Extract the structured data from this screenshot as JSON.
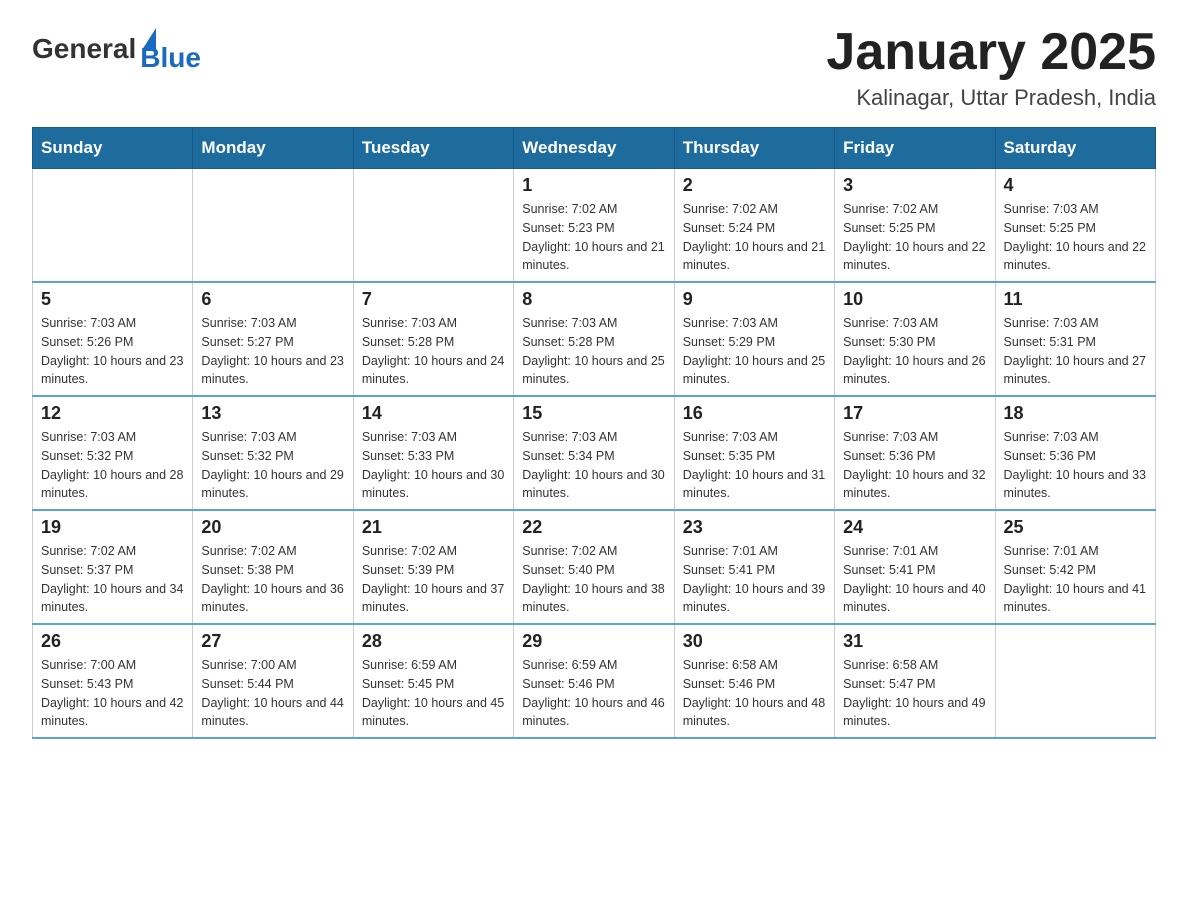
{
  "header": {
    "logo": {
      "text_general": "General",
      "text_blue": "Blue",
      "triangle_label": "logo-triangle"
    },
    "title": "January 2025",
    "subtitle": "Kalinagar, Uttar Pradesh, India"
  },
  "calendar": {
    "days_of_week": [
      "Sunday",
      "Monday",
      "Tuesday",
      "Wednesday",
      "Thursday",
      "Friday",
      "Saturday"
    ],
    "weeks": [
      [
        {
          "day": "",
          "info": ""
        },
        {
          "day": "",
          "info": ""
        },
        {
          "day": "",
          "info": ""
        },
        {
          "day": "1",
          "info": "Sunrise: 7:02 AM\nSunset: 5:23 PM\nDaylight: 10 hours and 21 minutes."
        },
        {
          "day": "2",
          "info": "Sunrise: 7:02 AM\nSunset: 5:24 PM\nDaylight: 10 hours and 21 minutes."
        },
        {
          "day": "3",
          "info": "Sunrise: 7:02 AM\nSunset: 5:25 PM\nDaylight: 10 hours and 22 minutes."
        },
        {
          "day": "4",
          "info": "Sunrise: 7:03 AM\nSunset: 5:25 PM\nDaylight: 10 hours and 22 minutes."
        }
      ],
      [
        {
          "day": "5",
          "info": "Sunrise: 7:03 AM\nSunset: 5:26 PM\nDaylight: 10 hours and 23 minutes."
        },
        {
          "day": "6",
          "info": "Sunrise: 7:03 AM\nSunset: 5:27 PM\nDaylight: 10 hours and 23 minutes."
        },
        {
          "day": "7",
          "info": "Sunrise: 7:03 AM\nSunset: 5:28 PM\nDaylight: 10 hours and 24 minutes."
        },
        {
          "day": "8",
          "info": "Sunrise: 7:03 AM\nSunset: 5:28 PM\nDaylight: 10 hours and 25 minutes."
        },
        {
          "day": "9",
          "info": "Sunrise: 7:03 AM\nSunset: 5:29 PM\nDaylight: 10 hours and 25 minutes."
        },
        {
          "day": "10",
          "info": "Sunrise: 7:03 AM\nSunset: 5:30 PM\nDaylight: 10 hours and 26 minutes."
        },
        {
          "day": "11",
          "info": "Sunrise: 7:03 AM\nSunset: 5:31 PM\nDaylight: 10 hours and 27 minutes."
        }
      ],
      [
        {
          "day": "12",
          "info": "Sunrise: 7:03 AM\nSunset: 5:32 PM\nDaylight: 10 hours and 28 minutes."
        },
        {
          "day": "13",
          "info": "Sunrise: 7:03 AM\nSunset: 5:32 PM\nDaylight: 10 hours and 29 minutes."
        },
        {
          "day": "14",
          "info": "Sunrise: 7:03 AM\nSunset: 5:33 PM\nDaylight: 10 hours and 30 minutes."
        },
        {
          "day": "15",
          "info": "Sunrise: 7:03 AM\nSunset: 5:34 PM\nDaylight: 10 hours and 30 minutes."
        },
        {
          "day": "16",
          "info": "Sunrise: 7:03 AM\nSunset: 5:35 PM\nDaylight: 10 hours and 31 minutes."
        },
        {
          "day": "17",
          "info": "Sunrise: 7:03 AM\nSunset: 5:36 PM\nDaylight: 10 hours and 32 minutes."
        },
        {
          "day": "18",
          "info": "Sunrise: 7:03 AM\nSunset: 5:36 PM\nDaylight: 10 hours and 33 minutes."
        }
      ],
      [
        {
          "day": "19",
          "info": "Sunrise: 7:02 AM\nSunset: 5:37 PM\nDaylight: 10 hours and 34 minutes."
        },
        {
          "day": "20",
          "info": "Sunrise: 7:02 AM\nSunset: 5:38 PM\nDaylight: 10 hours and 36 minutes."
        },
        {
          "day": "21",
          "info": "Sunrise: 7:02 AM\nSunset: 5:39 PM\nDaylight: 10 hours and 37 minutes."
        },
        {
          "day": "22",
          "info": "Sunrise: 7:02 AM\nSunset: 5:40 PM\nDaylight: 10 hours and 38 minutes."
        },
        {
          "day": "23",
          "info": "Sunrise: 7:01 AM\nSunset: 5:41 PM\nDaylight: 10 hours and 39 minutes."
        },
        {
          "day": "24",
          "info": "Sunrise: 7:01 AM\nSunset: 5:41 PM\nDaylight: 10 hours and 40 minutes."
        },
        {
          "day": "25",
          "info": "Sunrise: 7:01 AM\nSunset: 5:42 PM\nDaylight: 10 hours and 41 minutes."
        }
      ],
      [
        {
          "day": "26",
          "info": "Sunrise: 7:00 AM\nSunset: 5:43 PM\nDaylight: 10 hours and 42 minutes."
        },
        {
          "day": "27",
          "info": "Sunrise: 7:00 AM\nSunset: 5:44 PM\nDaylight: 10 hours and 44 minutes."
        },
        {
          "day": "28",
          "info": "Sunrise: 6:59 AM\nSunset: 5:45 PM\nDaylight: 10 hours and 45 minutes."
        },
        {
          "day": "29",
          "info": "Sunrise: 6:59 AM\nSunset: 5:46 PM\nDaylight: 10 hours and 46 minutes."
        },
        {
          "day": "30",
          "info": "Sunrise: 6:58 AM\nSunset: 5:46 PM\nDaylight: 10 hours and 48 minutes."
        },
        {
          "day": "31",
          "info": "Sunrise: 6:58 AM\nSunset: 5:47 PM\nDaylight: 10 hours and 49 minutes."
        },
        {
          "day": "",
          "info": ""
        }
      ]
    ]
  }
}
